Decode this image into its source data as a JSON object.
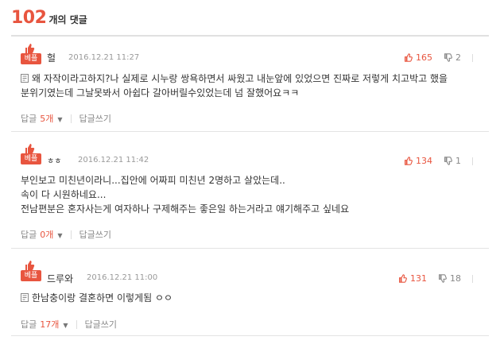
{
  "header": {
    "count": "102",
    "suffix": "개의 댓글"
  },
  "best_label": "베플",
  "comments": [
    {
      "author": "헐",
      "date": "2016.12.21 11:27",
      "likes": "165",
      "dislikes": "2",
      "lines": [
        "왜 자작이라고하지?나 실제로 시누랑 쌍욕하면서 싸웠고 내눈앞에 있었으면 진짜로 저렇게 치고박고 했을",
        "분위기였는데 그날못봐서 아쉽다 갈아버릴수있었는데 넘 잘했어요ㅋㅋ"
      ],
      "reply_label": "답글",
      "reply_count": "5개",
      "write_label": "답글쓰기"
    },
    {
      "author": "ㅎㅎ",
      "date": "2016.12.21 11:42",
      "likes": "134",
      "dislikes": "1",
      "lines": [
        "부인보고 미친년이라니...집안에 어짜피 미친년 2명하고 살았는데..",
        "속이 다 시원하네요...",
        "전남편분은 혼자사는게 여자하나 구제해주는 좋은일 하는거라고 얘기해주고 싶네요"
      ],
      "reply_label": "답글",
      "reply_count": "0개",
      "write_label": "답글쓰기"
    },
    {
      "author": "드루와",
      "date": "2016.12.21 11:00",
      "likes": "131",
      "dislikes": "18",
      "lines": [
        "한남충이랑 결혼하면 이렇게됨 ㅇㅇ"
      ],
      "reply_label": "답글",
      "reply_count": "17개",
      "write_label": "답글쓰기"
    }
  ]
}
